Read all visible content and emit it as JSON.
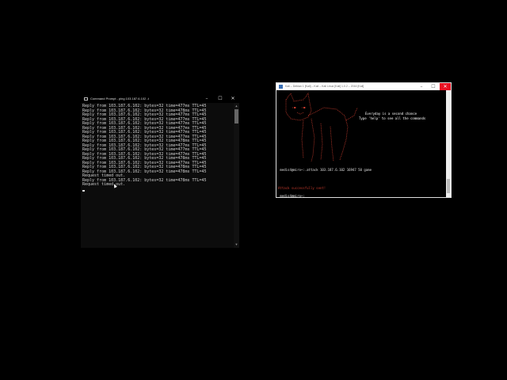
{
  "cmd": {
    "title": "Command Prompt - ping  103.187.6.102 -t",
    "window_controls": {
      "minimize": "–",
      "maximize": "☐",
      "close": "✕"
    },
    "lines": [
      "Reply from 103.187.6.102: bytes=32 time=477ms TTL=45",
      "Reply from 103.187.6.102: bytes=32 time=478ms TTL=45",
      "Reply from 103.187.6.102: bytes=32 time=477ms TTL=45",
      "Reply from 103.187.6.102: bytes=32 time=477ms TTL=45",
      "Reply from 103.187.6.102: bytes=32 time=477ms TTL=45",
      "Reply from 103.187.6.102: bytes=32 time=477ms TTL=45",
      "Reply from 103.187.6.102: bytes=32 time=477ms TTL=45",
      "Reply from 103.187.6.102: bytes=32 time=477ms TTL=45",
      "Reply from 103.187.6.102: bytes=32 time=478ms TTL=45",
      "Reply from 103.187.6.102: bytes=32 time=477ms TTL=45",
      "Reply from 103.187.6.102: bytes=32 time=477ms TTL=45",
      "Reply from 103.187.6.102: bytes=32 time=477ms TTL=45",
      "Reply from 103.187.6.102: bytes=32 time=478ms TTL=45",
      "Reply from 103.187.6.102: bytes=32 time=477ms TTL=45",
      "Reply from 103.187.6.102: bytes=32 time=478ms TTL=45",
      "Reply from 103.187.6.102: bytes=32 time=478ms TTL=45",
      "Request timed out.",
      "Reply from 103.187.6.102: bytes=32 time=478ms TTL=45",
      "Request timed out."
    ],
    "text_color": "#cfcfcf"
  },
  "term": {
    "title": "Kali – Debian 1 [Kali] – Kali – Kali Linux [Kali] 1.0.2 – 2016 [Kali]",
    "window_controls": {
      "minimize": "–",
      "maximize": "☐",
      "close": "✕"
    },
    "banner_line1": "Everyday is a second chance",
    "banner_line2": "Type 'help' to see all the commands",
    "prompt_command": " medis4@miro~:.attack 103.187.6.102 16947 50 game",
    "status_message": "Attack successfully sent!",
    "prompt_idle": " medis4@miro~:_",
    "colors": {
      "banner": "#ffffff",
      "prompt": "#e0e0e0",
      "status": "#c0392b",
      "art": "#c0392b"
    }
  }
}
